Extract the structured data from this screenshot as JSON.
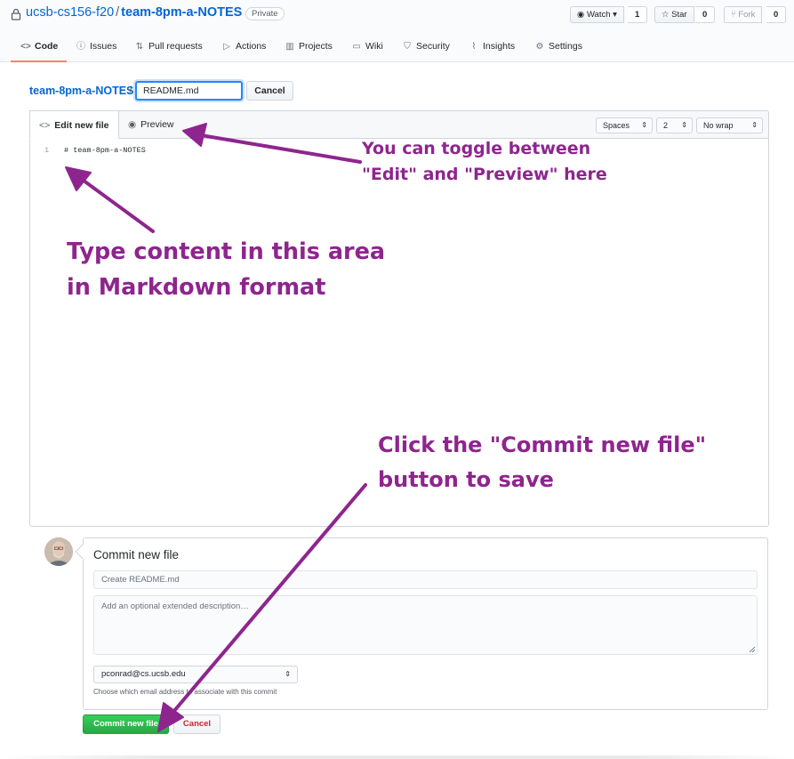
{
  "repo": {
    "owner": "ucsb-cs156-f20",
    "separator": "/",
    "name": "team-8pm-a-NOTES",
    "visibility": "Private",
    "watch_label": "Watch",
    "watch_count": "1",
    "star_label": "Star",
    "star_count": "0",
    "fork_label": "Fork",
    "fork_count": "0"
  },
  "tabs": [
    {
      "label": "Code",
      "icon": "code-icon"
    },
    {
      "label": "Issues",
      "icon": "issue-icon"
    },
    {
      "label": "Pull requests",
      "icon": "pull-request-icon"
    },
    {
      "label": "Actions",
      "icon": "play-icon"
    },
    {
      "label": "Projects",
      "icon": "project-icon"
    },
    {
      "label": "Wiki",
      "icon": "book-icon"
    },
    {
      "label": "Security",
      "icon": "shield-icon"
    },
    {
      "label": "Insights",
      "icon": "graph-icon"
    },
    {
      "label": "Settings",
      "icon": "gear-icon"
    }
  ],
  "path": {
    "repo_link": "team-8pm-a-NOTES",
    "separator": "/",
    "filename": "README.md",
    "cancel": "Cancel"
  },
  "editor": {
    "edit_tab": "Edit new file",
    "preview_tab": "Preview",
    "indent_mode": "Spaces",
    "indent_size": "2",
    "wrap_mode": "No wrap",
    "line_number": "1",
    "content": "# team-8pm-a-NOTES"
  },
  "commit": {
    "title": "Commit new file",
    "summary_placeholder": "Create README.md",
    "description_placeholder": "Add an optional extended description…",
    "email": "pconrad@cs.ucsb.edu",
    "email_note": "Choose which email address to associate with this commit",
    "commit_button": "Commit new file",
    "cancel_button": "Cancel"
  },
  "annotations": {
    "toggle_line1": "You can toggle between",
    "toggle_line2": "\"Edit\" and \"Preview\" here",
    "type_line1": "Type content in this area",
    "type_line2": "in Markdown format",
    "commit_line1": "Click the \"Commit new file\"",
    "commit_line2": "button to save"
  },
  "colors": {
    "link": "#0366d6",
    "annotation": "#8e258e",
    "commit_green": "#28a745",
    "active_tab_underline": "#f9826c"
  }
}
